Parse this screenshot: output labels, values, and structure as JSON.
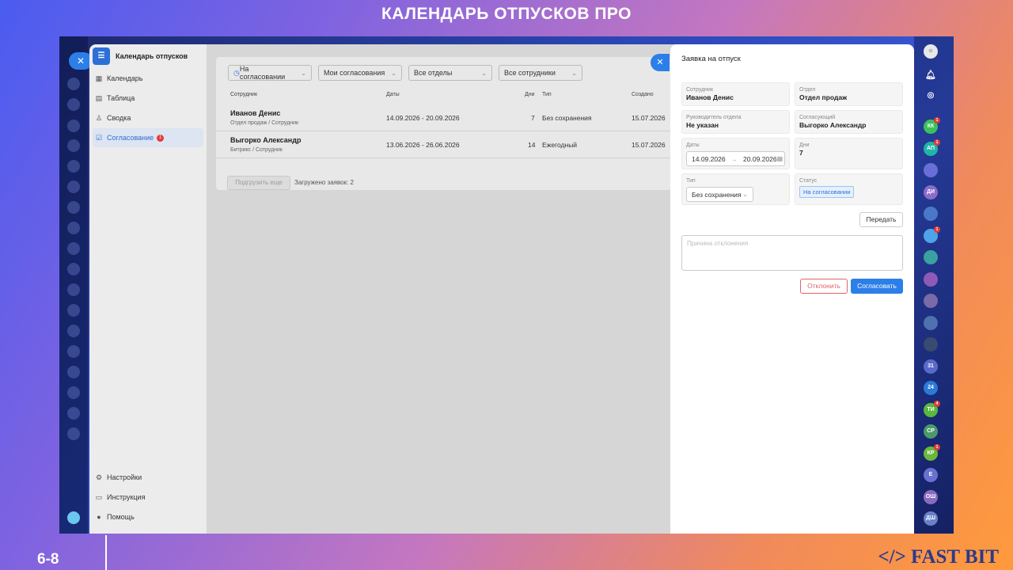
{
  "slide": {
    "title": "КАЛЕНДАРЬ ОТПУСКОВ ПРО",
    "page_number": "6-8",
    "brand": "</> FAST BIT"
  },
  "app": {
    "title": "Календарь отпусков",
    "nav": [
      {
        "label": "Календарь",
        "icon": "calendar-icon"
      },
      {
        "label": "Таблица",
        "icon": "table-icon"
      },
      {
        "label": "Сводка",
        "icon": "summary-icon"
      },
      {
        "label": "Согласование",
        "icon": "approval-icon",
        "badge": "1",
        "active": true
      }
    ],
    "bottom_nav": [
      {
        "label": "Настройки",
        "icon": "gear-icon"
      },
      {
        "label": "Инструкция",
        "icon": "book-icon"
      },
      {
        "label": "Помощь",
        "icon": "help-icon"
      }
    ]
  },
  "filters": [
    "На согласовании",
    "Мои согласования",
    "Все отделы",
    "Все сотрудники"
  ],
  "table": {
    "headers": {
      "employee": "Сотрудник",
      "dates": "Даты",
      "days": "Дни",
      "type": "Тип",
      "created": "Создано"
    },
    "rows": [
      {
        "name": "Иванов Денис",
        "sub": "Отдел продаж / Сотрудник",
        "dates": "14.09.2026 - 20.09.2026",
        "days": "7",
        "type": "Без сохранения",
        "created": "15.07.2026"
      },
      {
        "name": "Выгорко Александр",
        "sub": "Битрикс / Сотрудник",
        "dates": "13.06.2026 - 26.06.2026",
        "days": "14",
        "type": "Ежегодный",
        "created": "15.07.2026"
      }
    ],
    "load_more": "Подгрузить еще",
    "loaded_text": "Загружено заявок: 2"
  },
  "panel": {
    "title": "Заявка на отпуск",
    "employee_label": "Сотрудник",
    "employee": "Иванов Денис",
    "department_label": "Отдел",
    "department": "Отдел продаж",
    "manager_label": "Руководитель отдела",
    "manager": "Не указан",
    "approver_label": "Согласующий",
    "approver": "Выгорко Александр",
    "dates_label": "Даты",
    "date_from": "14.09.2026",
    "date_to": "20.09.2026",
    "days_label": "Дни",
    "days": "7",
    "type_label": "Тип",
    "type": "Без сохранения",
    "status_label": "Статус",
    "status": "На согласовании",
    "forward_button": "Передать",
    "reason_placeholder": "Причина отклонения",
    "reject_button": "Отклонить",
    "approve_button": "Согласовать"
  },
  "right_rail": [
    {
      "label": "КК",
      "color": "#3cc15a",
      "badge": "1"
    },
    {
      "label": "АП",
      "color": "#1fb5a8",
      "badge": "1"
    },
    {
      "label": "",
      "color": "#6a6fd8"
    },
    {
      "label": "ДИ",
      "color": "#8b6bc9"
    },
    {
      "label": "",
      "color": "#4a78c8"
    },
    {
      "label": "",
      "color": "#4fa3e8",
      "badge": "1"
    },
    {
      "label": "",
      "color": "#3aa0a0"
    },
    {
      "label": "",
      "color": "#8e5ab8"
    },
    {
      "label": "",
      "color": "#7a6aa8"
    },
    {
      "label": "",
      "color": "#5070b0"
    },
    {
      "label": "",
      "color": "#3a4a70"
    },
    {
      "label": "31",
      "color": "#5a6ac8"
    },
    {
      "label": "24",
      "color": "#2a7ad8"
    },
    {
      "label": "ТИ",
      "color": "#5ab83c",
      "badge": "4"
    },
    {
      "label": "СР",
      "color": "#4a9a6a"
    },
    {
      "label": "КР",
      "color": "#6ab83c",
      "badge": "1"
    },
    {
      "label": "Е",
      "color": "#6a70d0"
    },
    {
      "label": "ОШ",
      "color": "#8a6ac0"
    },
    {
      "label": "ДШ",
      "color": "#6a80c8"
    }
  ]
}
